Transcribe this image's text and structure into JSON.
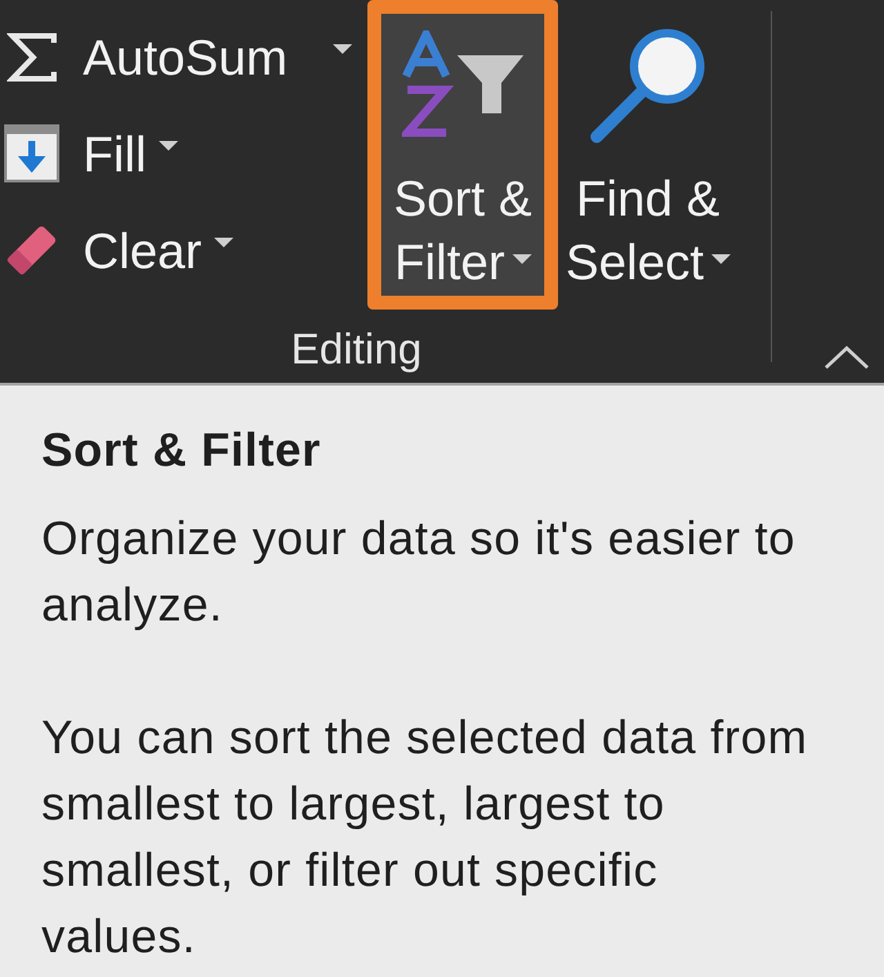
{
  "ribbon": {
    "group": {
      "label": "Editing",
      "small_buttons": [
        {
          "label": "AutoSum",
          "kind": "split"
        },
        {
          "label": "Fill",
          "kind": "menu"
        },
        {
          "label": "Clear",
          "kind": "menu"
        }
      ],
      "large_buttons": [
        {
          "label": "Sort & Filter",
          "highlighted": true
        },
        {
          "label": "Find & Select",
          "highlighted": false
        }
      ]
    }
  },
  "tooltip": {
    "title": "Sort & Filter",
    "paragraphs": [
      "Organize your data so it's easier to\nanalyze.",
      "You can sort the selected data from\nsmallest to largest, largest to\nsmallest, or filter out specific\nvalues."
    ]
  }
}
